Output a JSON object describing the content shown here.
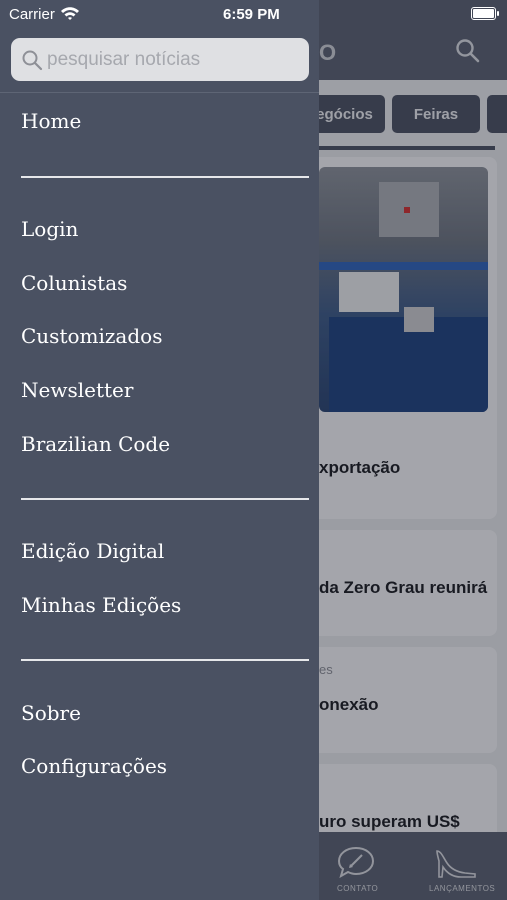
{
  "status_bar": {
    "carrier": "Carrier",
    "time": "6:59 PM"
  },
  "drawer": {
    "search_placeholder": "pesquisar notícias",
    "groups": [
      [
        "Home"
      ],
      [
        "Login",
        "Colunistas",
        "Customizados",
        "Newsletter",
        "Brazilian Code"
      ],
      [
        "Edição Digital",
        "Minhas Edições"
      ],
      [
        "Sobre",
        "Configurações"
      ]
    ]
  },
  "background": {
    "logo_fragment": "O",
    "tabs": [
      "egócios",
      "Feiras"
    ],
    "cards": [
      {
        "title": "xportação"
      },
      {
        "title": "da Zero Grau reunirá"
      },
      {
        "meta": "es",
        "title": "onexão"
      },
      {
        "title": "uro superam US$"
      }
    ],
    "bottom_nav": [
      "CONTATO",
      "LANÇAMENTOS"
    ]
  },
  "colors": {
    "drawer_bg": "#4a5162",
    "header_bg": "#5a6070",
    "divider": "#e6e7ea"
  }
}
